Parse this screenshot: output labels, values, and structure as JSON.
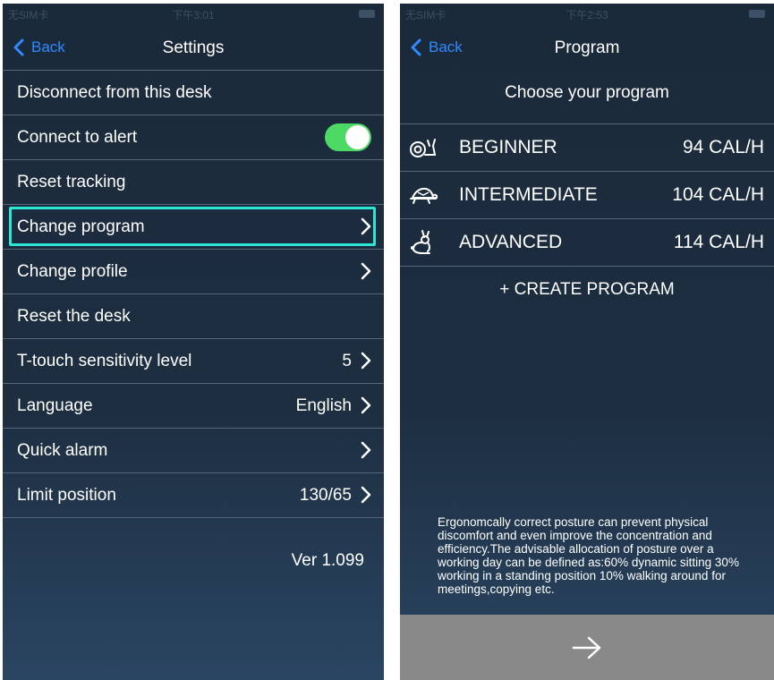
{
  "status_left": {
    "carrier": "无SIM卡",
    "time": "下午3:01"
  },
  "status_right": {
    "carrier": "无SIM卡",
    "time": "下午2:53"
  },
  "settings": {
    "back_label": "Back",
    "title": "Settings",
    "rows": [
      {
        "label": "Disconnect from this desk"
      },
      {
        "label": "Connect to alert"
      },
      {
        "label": "Reset tracking"
      },
      {
        "label": "Change program"
      },
      {
        "label": "Change profile"
      },
      {
        "label": "Reset the desk"
      },
      {
        "label": "T-touch sensitivity level",
        "value": "5"
      },
      {
        "label": "Language",
        "value": "English"
      },
      {
        "label": "Quick alarm"
      },
      {
        "label": "Limit position",
        "value": "130/65"
      }
    ],
    "alert_toggle_on": true,
    "version": "Ver 1.099"
  },
  "program": {
    "back_label": "Back",
    "title": "Program",
    "subtitle": "Choose your program",
    "items": [
      {
        "name": "BEGINNER",
        "calories": "94 CAL/H",
        "icon": "snail-icon"
      },
      {
        "name": "INTERMEDIATE",
        "calories": "104 CAL/H",
        "icon": "turtle-icon"
      },
      {
        "name": "ADVANCED",
        "calories": "114 CAL/H",
        "icon": "rabbit-icon"
      }
    ],
    "create_label": "+ CREATE PROGRAM",
    "note": "Ergonomcally correct posture can prevent physical discomfort and even improve the concentration and efficiency.The advisable allocation of posture over a working day can be defined as:60% dynamic sitting 30% working in a standing position 10% walking around for meetings,copying etc."
  },
  "colors": {
    "accent": "#2f8bff",
    "toggle_on": "#4cd964",
    "highlight": "#2ce6d4",
    "next_bar": "#898989"
  }
}
